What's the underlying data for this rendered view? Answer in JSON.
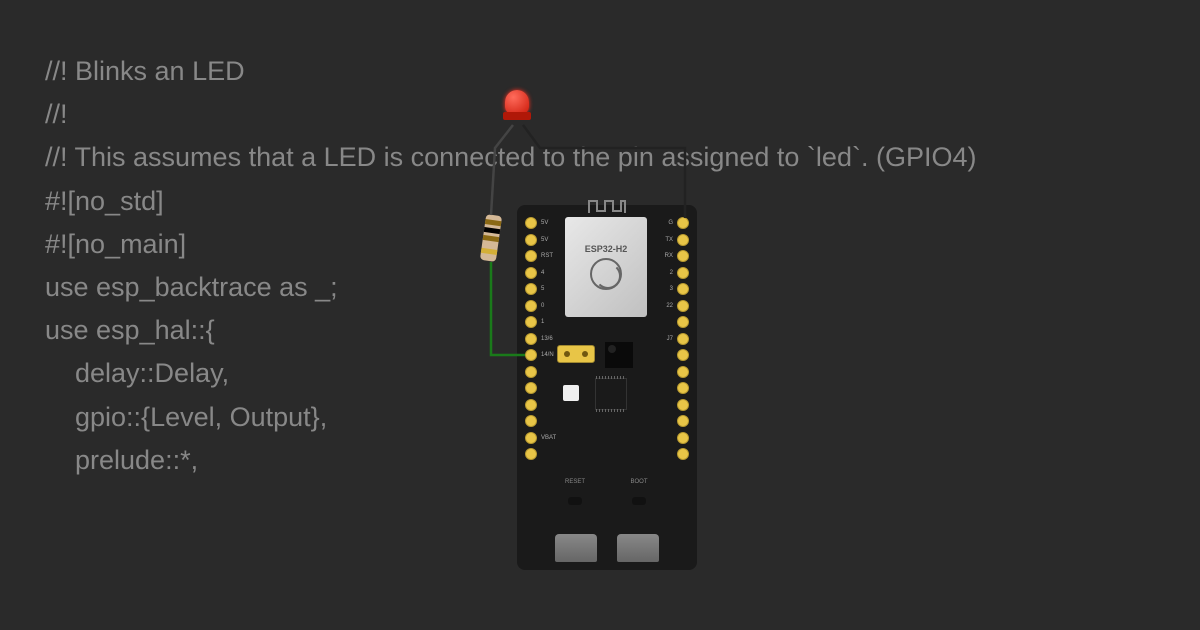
{
  "code": {
    "line1": "//! Blinks an LED",
    "line2": "//!",
    "line3": "//! This assumes that a LED is connected to the pin assigned to `led`. (GPIO4)",
    "line4": "",
    "line5": "#![no_std]",
    "line6": "#![no_main]",
    "line7": "",
    "line8": "use esp_backtrace as _;",
    "line9": "use esp_hal::{",
    "line10": "    delay::Delay,",
    "line11": "    gpio::{Level, Output},",
    "line12": "    prelude::*,"
  },
  "board": {
    "chip_label": "ESP32-H2",
    "reset_label": "RESET",
    "boot_label": "BOOT",
    "pins_left": [
      "5V",
      "5V",
      "RST",
      "4",
      "5",
      "0",
      "1",
      "13/6",
      "14/N",
      "",
      "",
      "",
      "",
      "VBAT",
      ""
    ],
    "pins_right": [
      "G",
      "TX",
      "RX",
      "2",
      "3",
      "22",
      "",
      "J7",
      "",
      "",
      "",
      "",
      "",
      "",
      ""
    ]
  }
}
